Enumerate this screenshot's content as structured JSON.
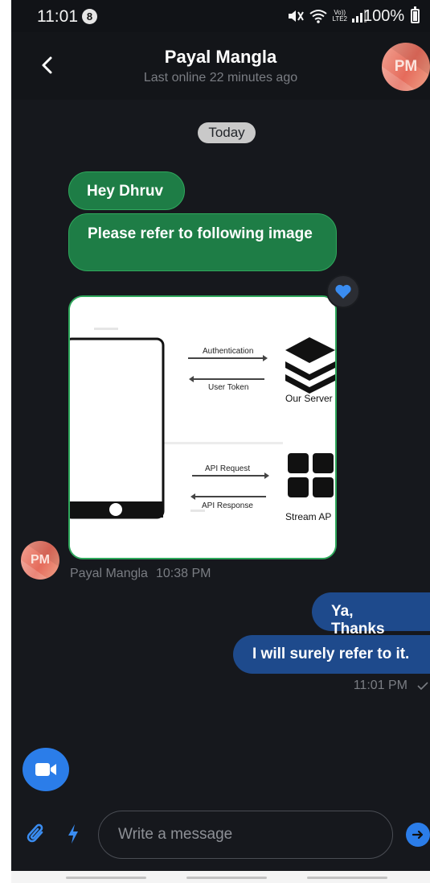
{
  "status_bar": {
    "time": "11:01",
    "notification_count": "8",
    "network_label": "Vo))\nLTE2",
    "battery_percent": "100%"
  },
  "header": {
    "contact_name": "Payal Mangla",
    "last_online": "Last online 22 minutes ago",
    "avatar_initials": "PM"
  },
  "chat": {
    "date_separator": "Today",
    "incoming": [
      {
        "text": "Hey Dhruv"
      },
      {
        "text": "Please refer to following image"
      }
    ],
    "image_attachment": {
      "labels": {
        "auth": "Authentication",
        "token": "User Token",
        "server": "Our Server",
        "api_request": "API Request",
        "api_response": "API Response",
        "stream": "Stream AP"
      }
    },
    "reaction": "heart-icon",
    "incoming_meta": {
      "sender": "Payal Mangla",
      "time": "10:38 PM",
      "avatar_initials": "PM"
    },
    "outgoing": [
      {
        "text": "Ya, Thanks"
      },
      {
        "text": "I will surely refer to it."
      }
    ],
    "outgoing_meta": {
      "time": "11:01 PM"
    }
  },
  "composer": {
    "placeholder": "Write a message",
    "value": ""
  },
  "colors": {
    "background": "#16181d",
    "incoming_bubble": "#1e7d46",
    "outgoing_bubble": "#1e4a8c",
    "accent": "#2b7de9"
  }
}
